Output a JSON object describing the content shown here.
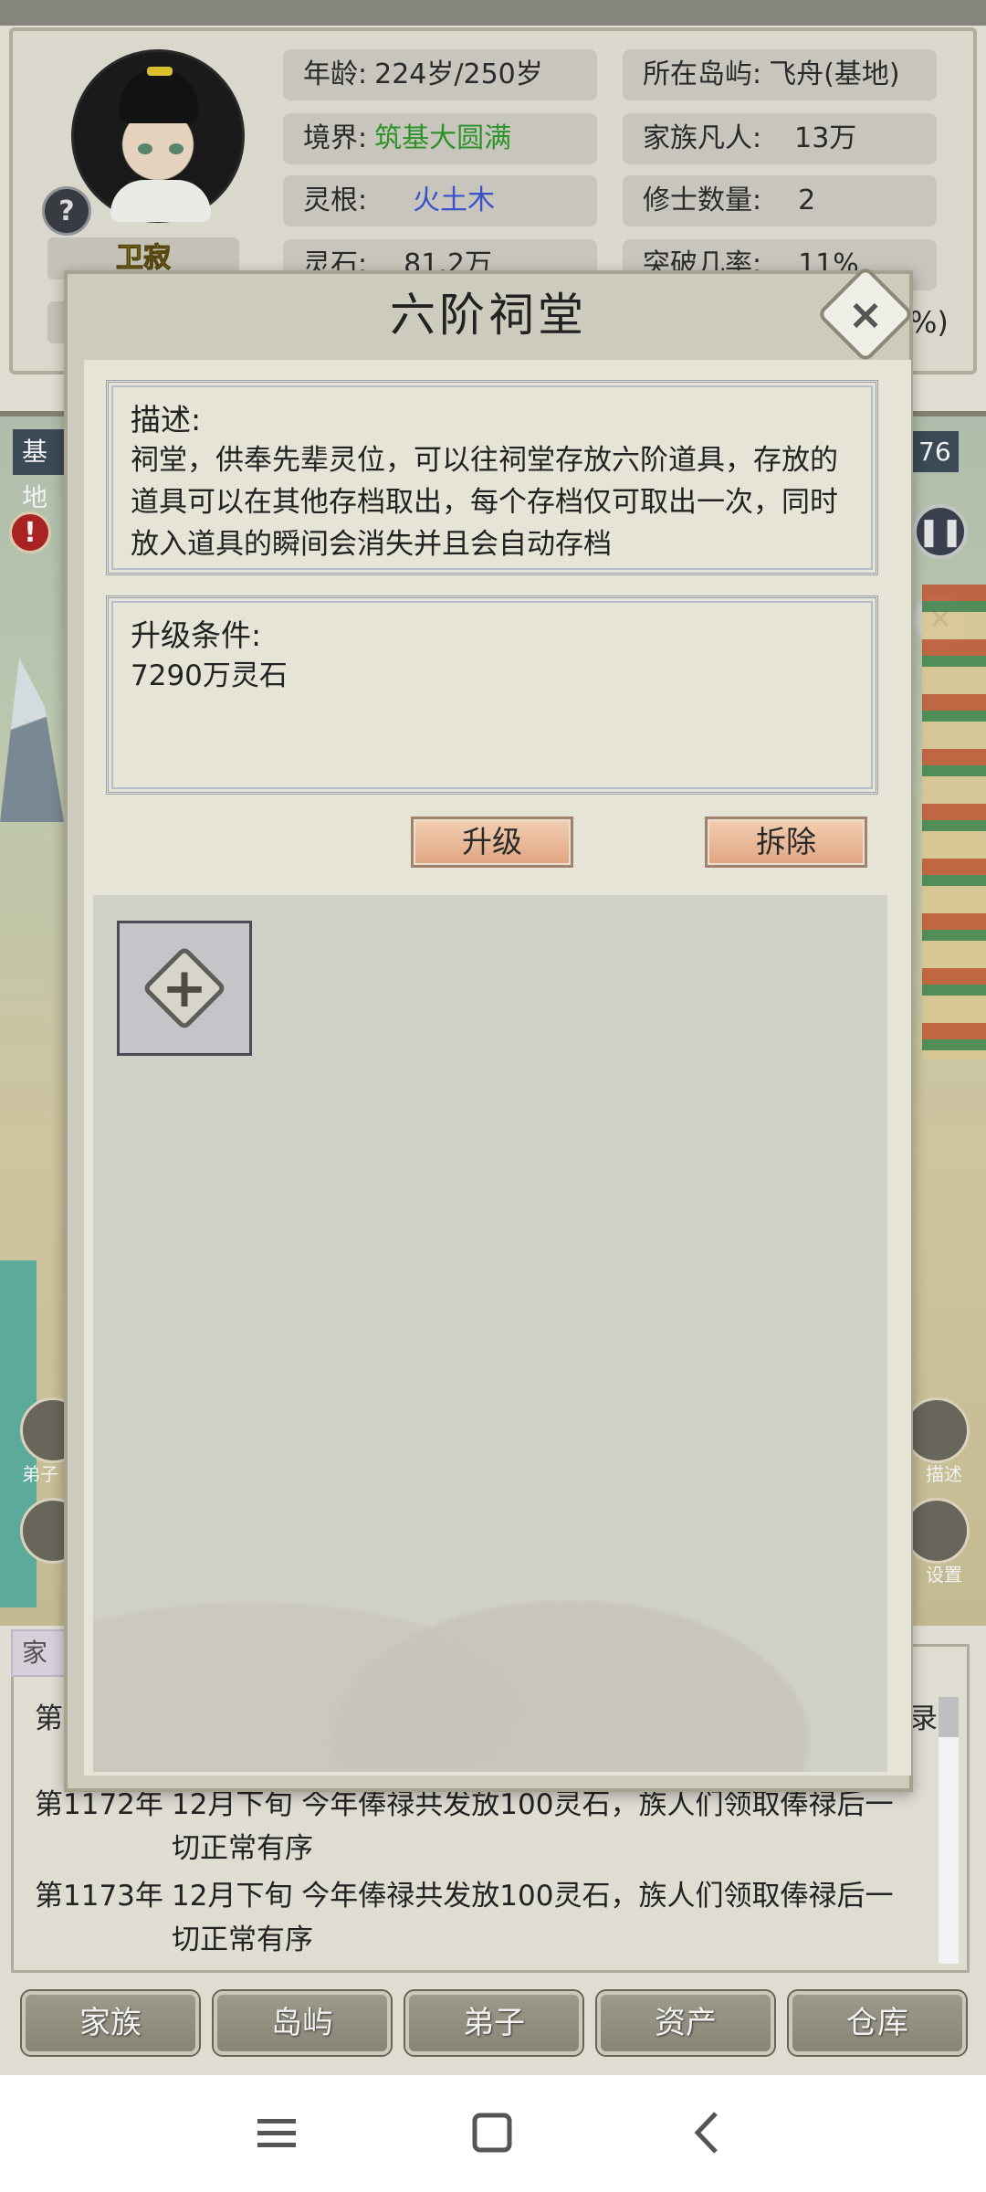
{
  "character": {
    "name": "卫寂",
    "help_icon": "?",
    "stats": {
      "age_label": "年龄:",
      "age_value": "224岁/250岁",
      "island_label": "所在岛屿:",
      "island_value": "飞舟(基地)",
      "realm_label": "境界:",
      "realm_value": "筑基大圆满",
      "family_label": "家族凡人:",
      "family_value": "13万",
      "root_label": "灵根:",
      "root_value": "火土木",
      "cultivator_label": "修士数量:",
      "cultivator_value": "2",
      "stone_label": "灵石:",
      "stone_value": "81.2万",
      "breakthrough_label": "突破几率:",
      "breakthrough_value": "11%",
      "pct_fragment": "%)"
    },
    "colors": {
      "realm": "#2e9a2a",
      "root": "#3d53d9",
      "name": "#e7c62b"
    }
  },
  "map": {
    "label": "基地",
    "number": "76",
    "alert_icon": "!",
    "pause_icon": "pause-icon",
    "close_icon": "close-icon",
    "side_labels": [
      "弟子",
      "描述",
      "设置"
    ]
  },
  "modal": {
    "title": "六阶祠堂",
    "close_icon": "×",
    "description": {
      "heading": "描述:",
      "text": "祠堂，供奉先辈灵位，可以往祠堂存放六阶道具，存放的道具可以在其他存档取出，每个存档仅可取出一次，同时放入道具的瞬间会消失并且会自动存档"
    },
    "upgrade": {
      "heading": "升级条件:",
      "text": "7290万灵石"
    },
    "buttons": {
      "upgrade": "升级",
      "demolish": "拆除"
    },
    "add_slot_icon": "+"
  },
  "log": {
    "tab_label": "家",
    "fragment_left": "第",
    "fragment_right": "录",
    "entries": [
      {
        "year": "第1172年",
        "text": "12月下旬 今年俸禄共发放100灵石，族人们领取俸禄后一切正常有序"
      },
      {
        "year": "第1173年",
        "text": "12月下旬 今年俸禄共发放100灵石，族人们领取俸禄后一切正常有序"
      }
    ]
  },
  "nav": {
    "items": [
      "家族",
      "岛屿",
      "弟子",
      "资产",
      "仓库"
    ]
  },
  "system_bar": {
    "menu_icon": "menu-icon",
    "home_icon": "home-icon",
    "back_icon": "back-icon"
  }
}
